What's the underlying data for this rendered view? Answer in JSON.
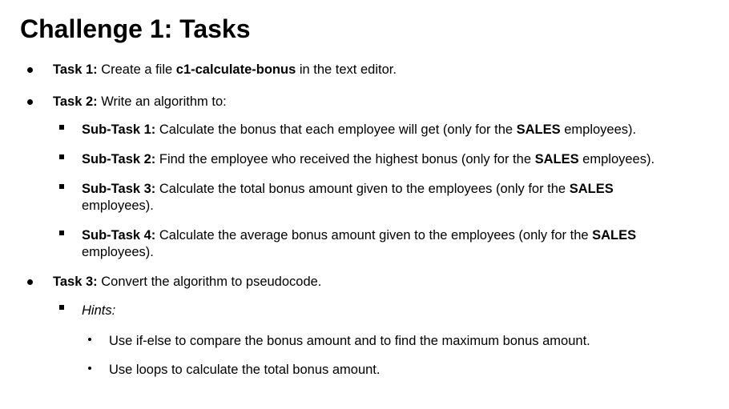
{
  "title": "Challenge 1: Tasks",
  "tasks": [
    {
      "label": "Task 1:",
      "text_before": " Create a file ",
      "file": "c1-calculate-bonus",
      "text_after": " in the text editor."
    },
    {
      "label": "Task 2:",
      "text": " Write an algorithm to:",
      "subtasks": [
        {
          "label": "Sub-Task 1:",
          "text": " Calculate the bonus that each employee will get (only for the ",
          "bold": "SALES",
          "end": " employees)."
        },
        {
          "label": "Sub-Task 2:",
          "text": " Find the employee who received the highest bonus (only for the ",
          "bold": "SALES",
          "end": " employees)."
        },
        {
          "label": "Sub-Task 3:",
          "text": " Calculate the total bonus amount given to the employees (only for the ",
          "bold": "SALES",
          "end": "employees)."
        },
        {
          "label": "Sub-Task 4:",
          "text": " Calculate the average bonus amount given to the employees (only for the ",
          "bold": "SALES",
          "end": "employees)."
        }
      ]
    },
    {
      "label": "Task 3:",
      "text": " Convert the algorithm to pseudocode.",
      "hints_label": "Hints:",
      "hints": [
        "Use if-else to compare the bonus amount and to find the maximum bonus amount.",
        "Use loops to calculate the total bonus amount."
      ]
    }
  ]
}
